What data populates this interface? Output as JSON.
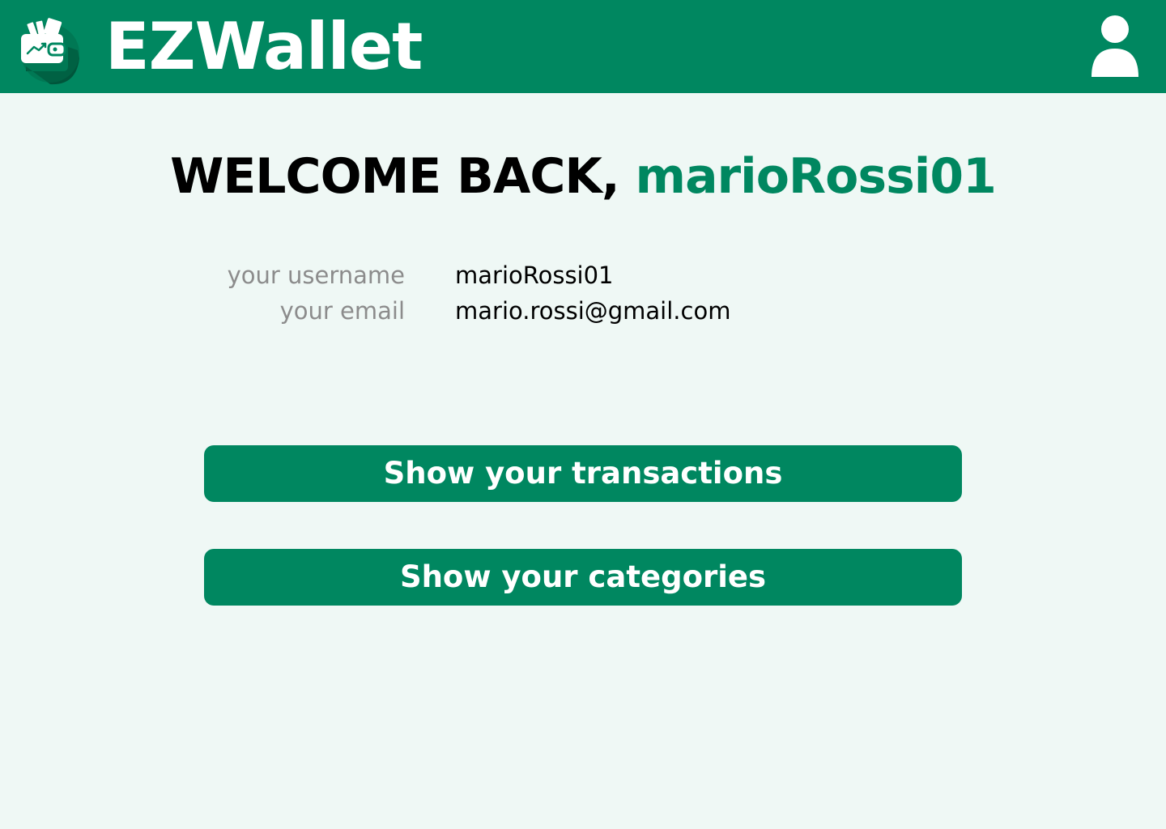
{
  "header": {
    "app_name": "EZWallet",
    "logo_icon": "wallet-icon",
    "profile_icon": "user-icon",
    "background_color": "#008760"
  },
  "welcome": {
    "prefix": "WELCOME BACK, ",
    "username": "marioRossi01",
    "accent_color": "#008760"
  },
  "profile_info": {
    "username_label": "your username",
    "username_value": "marioRossi01",
    "email_label": "your email",
    "email_value": "mario.rossi@gmail.com"
  },
  "actions": {
    "transactions_label": "Show your transactions",
    "categories_label": "Show your categories"
  }
}
